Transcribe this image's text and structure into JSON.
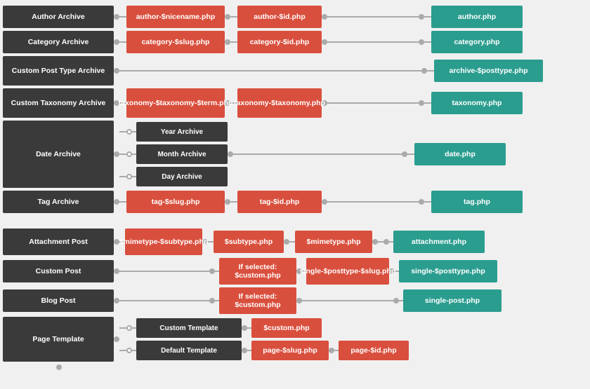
{
  "rows": [
    {
      "id": "author-archive",
      "label": "Author Archive",
      "nodes": [
        {
          "text": "author-$nicename.php",
          "type": "red"
        },
        {
          "text": "author-$id.php",
          "type": "red"
        },
        {
          "text": "author.php",
          "type": "teal"
        }
      ]
    },
    {
      "id": "category-archive",
      "label": "Category Archive",
      "nodes": [
        {
          "text": "category-$slug.php",
          "type": "red"
        },
        {
          "text": "category-$id.php",
          "type": "red"
        },
        {
          "text": "category.php",
          "type": "teal"
        }
      ]
    },
    {
      "id": "custom-post-type-archive",
      "label": "Custom Post Type Archive",
      "nodes": [
        {
          "text": "archive-$posttype.php",
          "type": "teal"
        }
      ],
      "skip": [
        0,
        1
      ]
    },
    {
      "id": "custom-taxonomy-archive",
      "label": "Custom Taxonomy Archive",
      "nodes": [
        {
          "text": "taxonomy-$taxonomy-$term.php",
          "type": "red"
        },
        {
          "text": "taxonomy-$taxonomy.php",
          "type": "red"
        },
        {
          "text": "taxonomy.php",
          "type": "teal"
        }
      ]
    },
    {
      "id": "date-archive",
      "label": "Date Archive",
      "subitems": [
        "Year Archive",
        "Month Archive",
        "Day Archive"
      ],
      "nodes": [
        {
          "text": "date.php",
          "type": "teal"
        }
      ]
    },
    {
      "id": "tag-archive",
      "label": "Tag Archive",
      "nodes": [
        {
          "text": "tag-$slug.php",
          "type": "red"
        },
        {
          "text": "tag-$id.php",
          "type": "red"
        },
        {
          "text": "tag.php",
          "type": "teal"
        }
      ]
    }
  ],
  "rows2": [
    {
      "id": "attachment-post",
      "label": "Attachment Post",
      "nodes": [
        {
          "text": "$mimetype-$subtype.php",
          "type": "red"
        },
        {
          "text": "$subtype.php",
          "type": "red"
        },
        {
          "text": "$mimetype.php",
          "type": "red"
        },
        {
          "text": "attachment.php",
          "type": "teal"
        }
      ]
    },
    {
      "id": "custom-post",
      "label": "Custom Post",
      "nodes": [
        {
          "text": "If selected: $custom.php",
          "type": "red",
          "skip_first": true
        },
        {
          "text": "single-$posttype-$slug.php",
          "type": "red"
        },
        {
          "text": "single-$posttype.php",
          "type": "teal"
        }
      ]
    },
    {
      "id": "blog-post",
      "label": "Blog Post",
      "nodes": [
        {
          "text": "If selected: $custom.php",
          "type": "red",
          "skip_first": true
        },
        {
          "text": "single-post.php",
          "type": "teal"
        }
      ]
    },
    {
      "id": "page-template",
      "label": "Page Template",
      "subitems": [
        {
          "label": "Custom Template",
          "nodes": [
            {
              "text": "$custom.php",
              "type": "red"
            }
          ]
        },
        {
          "label": "Default Template",
          "nodes": [
            {
              "text": "page-$slug.php",
              "type": "red"
            },
            {
              "text": "page-$id.php",
              "type": "red"
            }
          ]
        }
      ]
    }
  ]
}
